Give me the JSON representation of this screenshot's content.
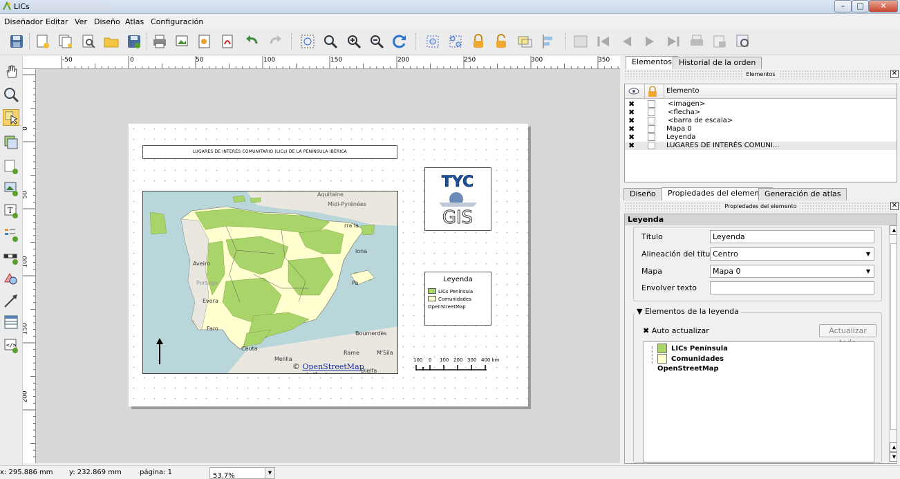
{
  "window": {
    "title": "LICs"
  },
  "menu": [
    "Diseñador",
    "Editar",
    "Ver",
    "Diseño",
    "Atlas",
    "Configuración"
  ],
  "ruler_top_labels": [
    "-50",
    "0",
    "50",
    "100",
    "150",
    "200",
    "250",
    "300",
    "350"
  ],
  "ruler_left_labels": [
    "0",
    "50",
    "100",
    "150",
    "200"
  ],
  "layout": {
    "title_text": "LUGARES DE INTERÉS COMUNITARIO (LICs) DE LA PENÍNSULA IBÉRICA",
    "map_labels": {
      "aquitaine": "Aquitaine",
      "midi": "Midi-Pyrénées",
      "porra": "rra la",
      "aveiro": "Aveiro",
      "portugal": "Portuga",
      "evora": "Evora",
      "faro": "Faro",
      "ceuta": "Ceuta",
      "melilla": "Melilla",
      "bourmerdes": "Boumerdès",
      "rame": "Rame",
      "msila": "M'Sila",
      "djelfa": "Djelfa",
      "lona": "lona",
      "pa": "Pa"
    },
    "osm_symbol": "©",
    "osm_link": "OpenStreetMap",
    "osm_contrib": " contributors",
    "logo_top": "TYC",
    "logo_bottom": "GIS",
    "legend_title": "Leyenda",
    "legend_items": [
      "LICs Península",
      "Comunidades",
      "OpenStreetMap"
    ],
    "scale_labels": [
      "100",
      "0",
      "100",
      "200",
      "300",
      "400 km"
    ]
  },
  "panel": {
    "tabs_top": [
      "Elementos",
      "Historial de la orden"
    ],
    "elements_header": "Elementos",
    "column_element": "Elemento",
    "elements": [
      "<imagen>",
      "<flecha>",
      "<barra de escala>",
      "Mapa 0",
      "Leyenda",
      "LUGARES DE INTERÉS COMUNI..."
    ],
    "check_mark": "✖",
    "tabs_bottom": [
      "Diseño",
      "Propiedades del elemento",
      "Generación de atlas"
    ],
    "props_header": "Propiedades del elemento",
    "props_title": "Leyenda",
    "fields": {
      "titulo_label": "Título",
      "titulo_value": "Leyenda",
      "alineacion_label": "Alineación del título:",
      "alineacion_value": "Centro",
      "mapa_label": "Mapa",
      "mapa_value": "Mapa 0",
      "envolver_label": "Envolver texto",
      "envolver_value": ""
    },
    "legend_items_group": "Elementos de la leyenda",
    "auto_update": "Auto actualizar",
    "update_all": "Actualizar todo",
    "tree": [
      "LICs Península",
      "Comunidades",
      "OpenStreetMap"
    ]
  },
  "status": {
    "x": "x: 295.886 mm",
    "y": "y: 232.869 mm",
    "page": "página: 1",
    "zoom": "53.7%"
  },
  "colors": {
    "lic_fill": "#a8d46a",
    "comunidades_fill": "#ffffd0",
    "sea": "#b8d4d8",
    "land": "#e9e7df"
  }
}
